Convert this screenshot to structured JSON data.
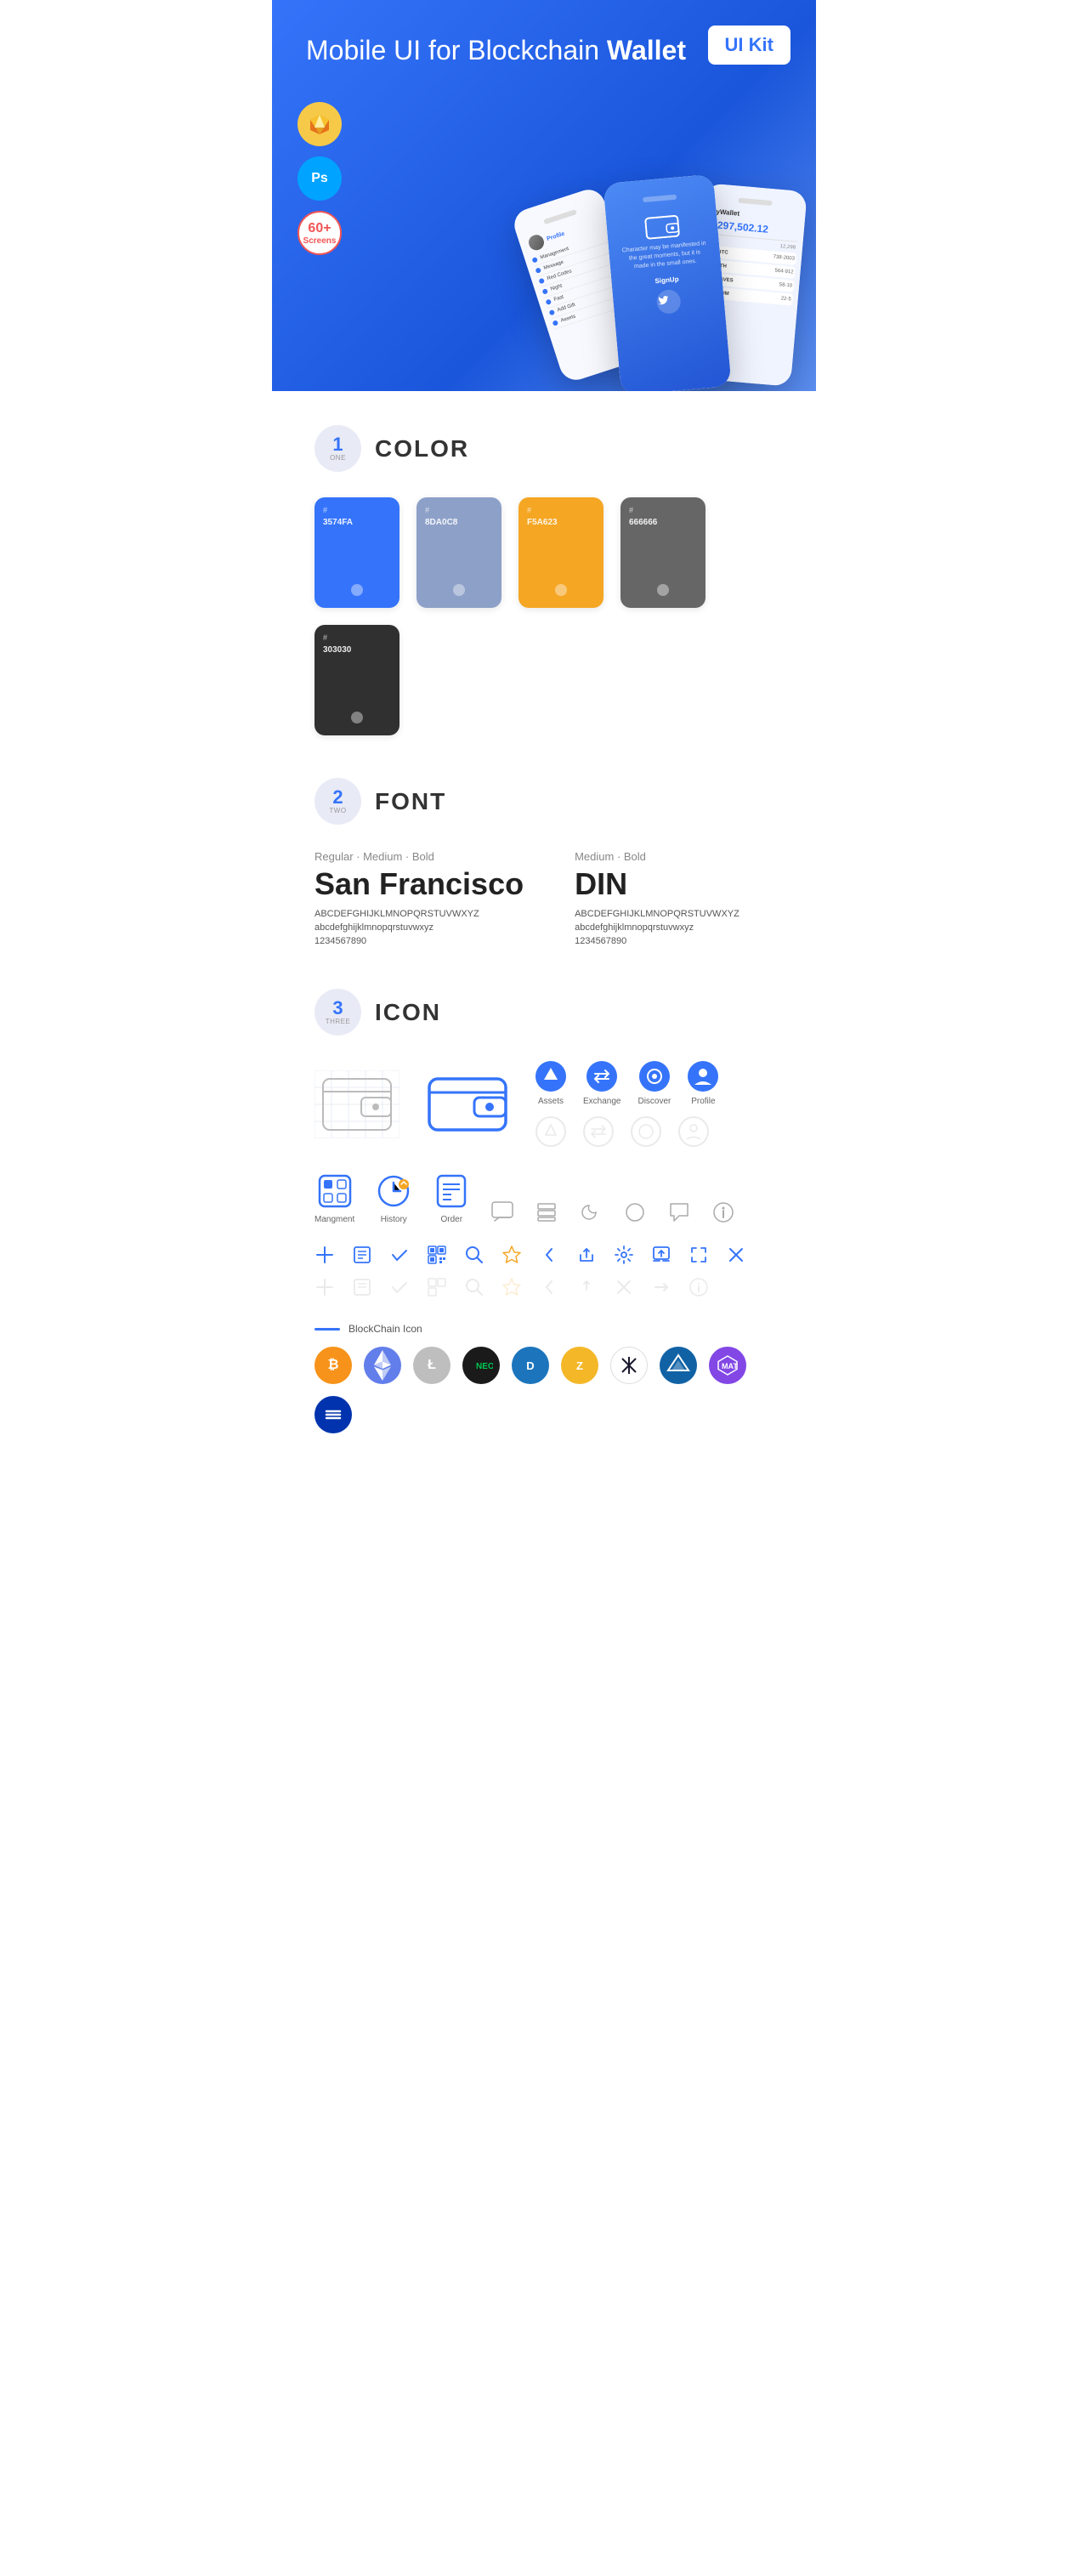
{
  "hero": {
    "title_regular": "Mobile UI for Blockchain ",
    "title_bold": "Wallet",
    "badge": "UI Kit",
    "badges": [
      {
        "id": "sketch",
        "symbol": "S",
        "bg": "#F7C948"
      },
      {
        "id": "photoshop",
        "symbol": "Ps",
        "bg": "#00A3FF"
      },
      {
        "id": "screens",
        "count": "60+",
        "label": "Screens",
        "bg": "#fff"
      }
    ]
  },
  "sections": {
    "color": {
      "number": "1",
      "word": "ONE",
      "title": "COLOR",
      "swatches": [
        {
          "hex": "#3574FA",
          "label": "3574FA",
          "dark": false
        },
        {
          "hex": "#8DA0C8",
          "label": "8DA0C8",
          "dark": false
        },
        {
          "hex": "#F5A623",
          "label": "F5A623",
          "dark": false
        },
        {
          "hex": "#666666",
          "label": "666666",
          "dark": false
        },
        {
          "hex": "#303030",
          "label": "303030",
          "dark": false
        }
      ]
    },
    "font": {
      "number": "2",
      "word": "TWO",
      "title": "FONT",
      "fonts": [
        {
          "meta": "Regular · Medium · Bold",
          "name": "San Francisco",
          "chars_upper": "ABCDEFGHIJKLMNOPQRSTUVWXYZ",
          "chars_lower": "abcdefghijklmnopqrstuvwxyz",
          "nums": "1234567890"
        },
        {
          "meta": "Medium · Bold",
          "name": "DIN",
          "chars_upper": "ABCDEFGHIJKLMNOPQRSTUVWXYZ",
          "chars_lower": "abcdefghijklmnopqrstuvwxyz",
          "nums": "1234567890"
        }
      ]
    },
    "icon": {
      "number": "3",
      "word": "THREE",
      "title": "ICON",
      "nav_icons": [
        {
          "id": "assets",
          "label": "Assets"
        },
        {
          "id": "exchange",
          "label": "Exchange"
        },
        {
          "id": "discover",
          "label": "Discover"
        },
        {
          "id": "profile",
          "label": "Profile"
        }
      ],
      "bottom_icons": [
        {
          "id": "management",
          "label": "Mangment"
        },
        {
          "id": "history",
          "label": "History"
        },
        {
          "id": "order",
          "label": "Order"
        }
      ],
      "misc_icons": [
        "plus",
        "clipboard",
        "check",
        "qr",
        "search",
        "star",
        "chevron-left",
        "share",
        "settings",
        "upload",
        "resize",
        "close"
      ],
      "blockchain_label": "BlockChain Icon",
      "crypto_coins": [
        {
          "id": "bitcoin",
          "symbol": "₿",
          "bg": "#F7931A",
          "color": "#fff"
        },
        {
          "id": "ethereum",
          "symbol": "Ξ",
          "bg": "#627EEA",
          "color": "#fff"
        },
        {
          "id": "litecoin",
          "symbol": "Ł",
          "bg": "#BFBBBB",
          "color": "#fff"
        },
        {
          "id": "neo",
          "symbol": "N",
          "bg": "#58BF00",
          "color": "#fff"
        },
        {
          "id": "dash",
          "symbol": "D",
          "bg": "#1C75BC",
          "color": "#fff"
        },
        {
          "id": "zcash",
          "symbol": "Z",
          "bg": "#F4B728",
          "color": "#fff"
        },
        {
          "id": "iota",
          "symbol": "◈",
          "bg": "#fff",
          "color": "#333",
          "border": "#ddd"
        },
        {
          "id": "ardor",
          "symbol": "A",
          "bg": "#1162A5",
          "color": "#fff"
        },
        {
          "id": "matic",
          "symbol": "M",
          "bg": "#8247E5",
          "color": "#fff"
        },
        {
          "id": "stripes",
          "symbol": "≋",
          "bg": "#0033AD",
          "color": "#fff"
        }
      ]
    }
  }
}
